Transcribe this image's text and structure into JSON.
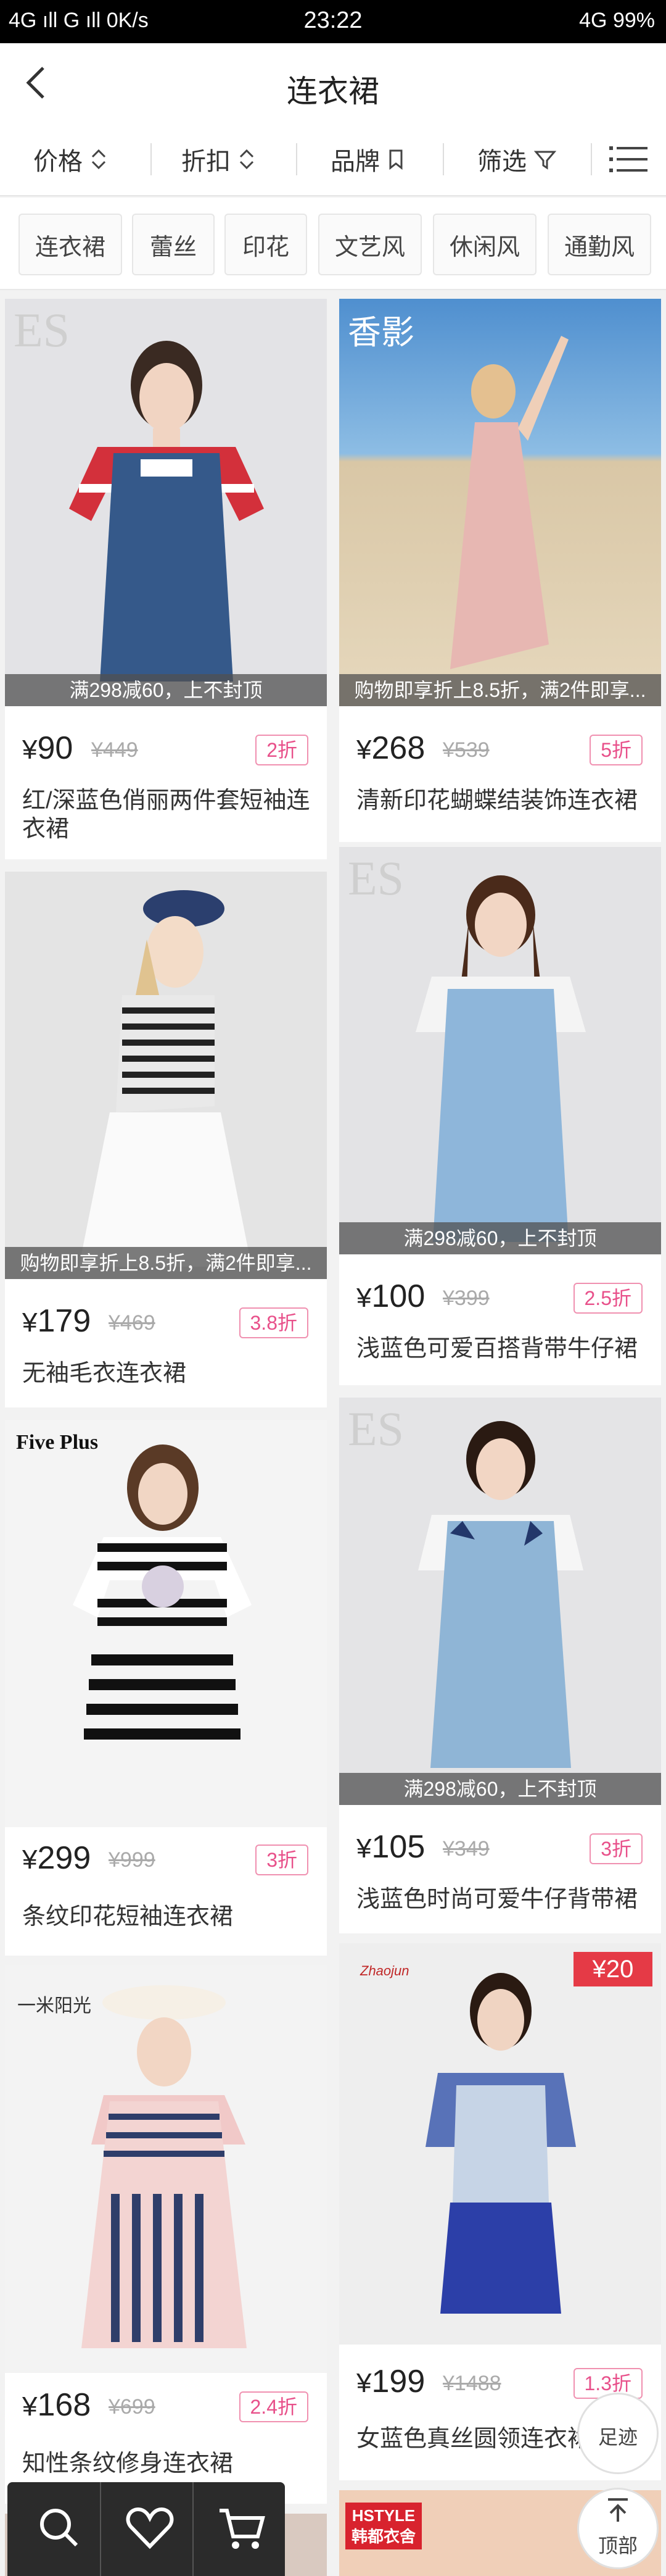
{
  "status_bar": {
    "left": "4G ıll  G ıll  0K/s",
    "time": "23:22",
    "right": "4G 99%"
  },
  "header": {
    "title": "连衣裙"
  },
  "sort_bar": {
    "price": "价格",
    "discount": "折扣",
    "brand": "品牌",
    "filter": "筛选"
  },
  "tags": [
    "连衣裙",
    "蕾丝",
    "印花",
    "文艺风",
    "休闲风",
    "通勤风"
  ],
  "products": [
    {
      "brand_mark": "ES",
      "promo": "满298减60，上不封顶",
      "currency": "¥",
      "price": "90",
      "orig_price": "¥449",
      "discount": "2折",
      "name": "红/深蓝色俏丽两件套短袖连衣裙"
    },
    {
      "brand_mark": "香影",
      "promo": "购物即享折上8.5折，满2件即享...",
      "currency": "¥",
      "price": "268",
      "orig_price": "¥539",
      "discount": "5折",
      "name": "清新印花蝴蝶结装饰连衣裙"
    },
    {
      "brand_mark": "",
      "promo": "购物即享折上8.5折，满2件即享...",
      "currency": "¥",
      "price": "179",
      "orig_price": "¥469",
      "discount": "3.8折",
      "name": "无袖毛衣连衣裙"
    },
    {
      "brand_mark": "ES",
      "promo": "满298减60，上不封顶",
      "currency": "¥",
      "price": "100",
      "orig_price": "¥399",
      "discount": "2.5折",
      "name": "浅蓝色可爱百搭背带牛仔裙"
    },
    {
      "brand_mark": "Five Plus",
      "promo": "",
      "currency": "¥",
      "price": "299",
      "orig_price": "¥999",
      "discount": "3折",
      "name": "条纹印花短袖连衣裙"
    },
    {
      "brand_mark": "ES",
      "promo": "满298减60，上不封顶",
      "currency": "¥",
      "price": "105",
      "orig_price": "¥349",
      "discount": "3折",
      "name": "浅蓝色时尚可爱牛仔背带裙"
    },
    {
      "brand_mark": "一米阳光",
      "promo": "",
      "currency": "¥",
      "price": "168",
      "orig_price": "¥699",
      "discount": "2.4折",
      "name": "知性条纹修身连衣裙"
    },
    {
      "brand_mark": "Zhaojun",
      "coupon": "¥20",
      "promo": "",
      "currency": "¥",
      "price": "199",
      "orig_price": "¥1488",
      "discount": "1.3折",
      "name": "女蓝色真丝圆领连衣裙"
    }
  ],
  "bottom_peek": {
    "brand_mark": "HSTYLE 韩都衣舍"
  },
  "float": {
    "footprint": "足迹",
    "top": "顶部"
  },
  "colors": {
    "accent": "#e8508a",
    "promo_bg": "#505050"
  }
}
